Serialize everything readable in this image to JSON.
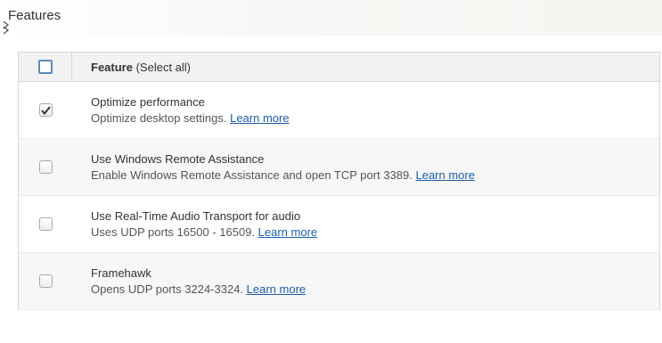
{
  "section": {
    "title": "Features"
  },
  "table": {
    "header": {
      "label_bold": "Feature",
      "label_select_all": "(Select all)",
      "checked": false
    },
    "rows": [
      {
        "title": "Optimize performance",
        "description": "Optimize desktop settings.",
        "link": "Learn more",
        "checked": true
      },
      {
        "title": "Use Windows Remote Assistance",
        "description": "Enable Windows Remote Assistance and open TCP port 3389.",
        "link": "Learn more",
        "checked": false
      },
      {
        "title": "Use Real-Time Audio Transport for audio",
        "description": "Uses UDP ports 16500 - 16509.",
        "link": "Learn more",
        "checked": false
      },
      {
        "title": "Framehawk",
        "description": "Opens UDP ports 3224-3324.",
        "link": "Learn more",
        "checked": false
      }
    ]
  },
  "colors": {
    "accent": "#5a8bbf",
    "link": "#1a5ea8",
    "check": "#333333"
  },
  "icons": {
    "collapse": "chevron-collapse-icon",
    "check": "checkmark-icon"
  }
}
